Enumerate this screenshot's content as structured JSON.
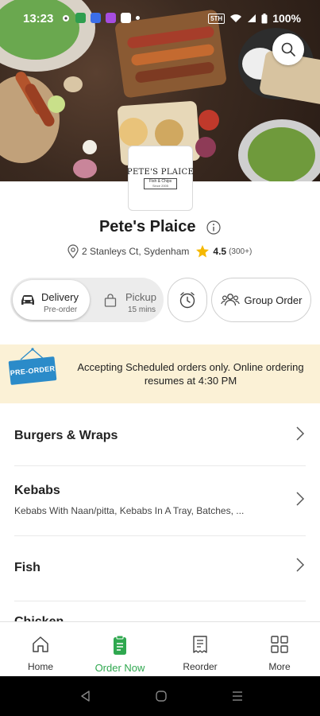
{
  "status_bar": {
    "time": "13:23",
    "network_badge": "5TH",
    "battery": "100%"
  },
  "search": {
    "icon": "search-icon"
  },
  "restaurant": {
    "logo": {
      "title": "PETE'S PLAICE",
      "subtitle": "Fish & Chips",
      "since": "Since 2005"
    },
    "name": "Pete's Plaice",
    "address": "2 Stanleys Ct, Sydenham",
    "rating": "4.5",
    "rating_count": "(300+)"
  },
  "order_mode": {
    "delivery": {
      "label": "Delivery",
      "sub": "Pre-order",
      "selected": true
    },
    "pickup": {
      "label": "Pickup",
      "sub": "15 mins"
    },
    "schedule_icon": "clock-icon",
    "group_order": "Group Order"
  },
  "banner": {
    "sign": "PRE-ORDER",
    "message": "Accepting Scheduled orders only. Online ordering resumes at 4:30 PM"
  },
  "categories": [
    {
      "title": "Burgers & Wraps",
      "subtitle": ""
    },
    {
      "title": "Kebabs",
      "subtitle": "Kebabs With Naan/pitta, Kebabs In A Tray, Batches, ..."
    },
    {
      "title": "Fish",
      "subtitle": ""
    },
    {
      "title": "Chicken",
      "subtitle": ""
    }
  ],
  "bottom_nav": [
    {
      "label": "Home",
      "icon": "home-icon"
    },
    {
      "label": "Order Now",
      "icon": "order-icon",
      "active": true
    },
    {
      "label": "Reorder",
      "icon": "receipt-icon"
    },
    {
      "label": "More",
      "icon": "grid-icon"
    }
  ],
  "colors": {
    "accent": "#2fa84f",
    "banner_bg": "#fbf1d6",
    "sign_blue": "#2b8bc9",
    "star": "#f5b800"
  }
}
